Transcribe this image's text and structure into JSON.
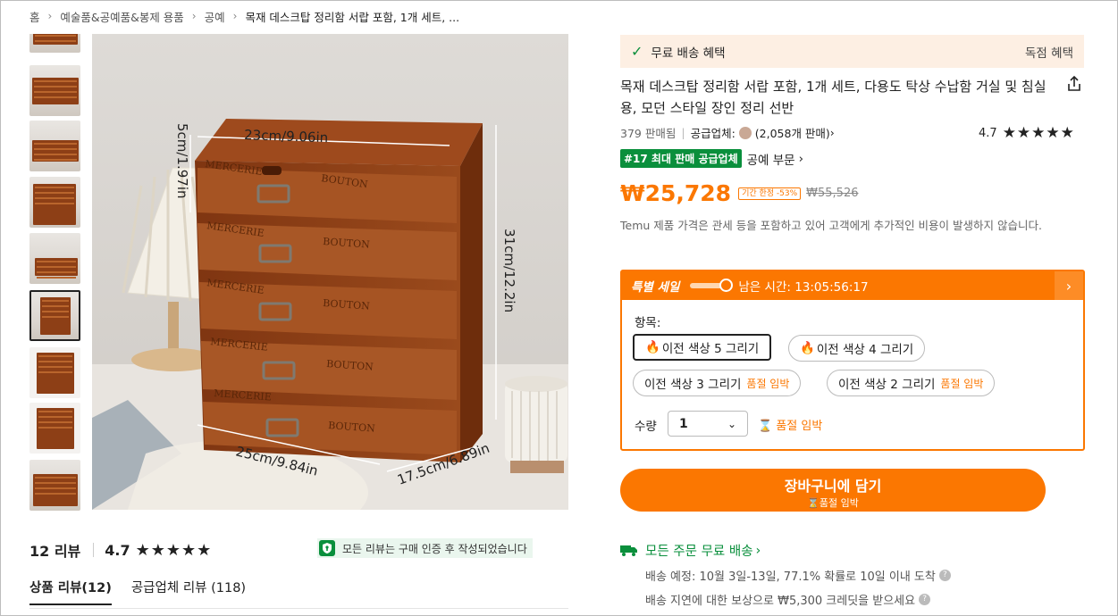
{
  "breadcrumb": [
    "홈",
    "예술품&공예품&봉제 용품",
    "공예",
    "목재 데스크탑 정리함 서랍 포함, 1개 세트, ..."
  ],
  "image_labels": {
    "width": "23cm/9.06in",
    "drawer_height": "5cm/1.97in",
    "height": "31cm/12.2in",
    "depth_front": "25cm/9.84in",
    "depth_side": "17.5cm/6.89in",
    "drawer_text_left": "MERCERIE",
    "drawer_text_right": "BOUTON"
  },
  "benefit": {
    "label": "무료 배송 혜택",
    "right": "독점 혜택"
  },
  "product": {
    "title": "목재 데스크탑 정리함 서랍 포함, 1개 세트, 다용도 탁상 수납함 거실 및 침실용, 모던 스타일 장인 정리 선반",
    "sold": "379 판매됨",
    "seller_label": "공급업체:",
    "seller_sales": "(2,058개 판매)",
    "rating": "4.7",
    "rank_badge": "#17 최대 판매 공급업체",
    "rank_category": "공예 부문"
  },
  "price": {
    "current": "₩25,728",
    "limited_badge": "기간 한정 -53%",
    "original": "₩55,526",
    "note": "Temu 제품 가격은 관세 등을 포함하고 있어 고객에게 추가적인 비용이 발생하지 않습니다."
  },
  "sale": {
    "title": "특별 세일",
    "timer_label": "남은 시간: 13:05:56:17",
    "timer_progress": 0.9,
    "options_label": "항목:",
    "options": [
      {
        "label": "이전 색상 5 그리기",
        "selected": true,
        "sold_out": ""
      },
      {
        "label": "이전 색상 4 그리기",
        "selected": false,
        "sold_out": ""
      },
      {
        "label": "이전 색상 3 그리기",
        "selected": false,
        "sold_out": "품절 임박"
      },
      {
        "label": "이전 색상 2 그리기",
        "selected": false,
        "sold_out": "품절 임박"
      }
    ],
    "qty_label": "수량",
    "qty_value": "1",
    "stock_note": "품절 임박"
  },
  "cart": {
    "label": "장바구니에 담기",
    "sub": "품절 임박"
  },
  "shipping": {
    "head": "모든 주문 무료 배송",
    "eta": "배송 예정: 10월 3일-13일, 77.1% 확률로 10일 이내 도착",
    "delay": "배송 지연에 대한 보상으로 ₩5,300 크레딧을 받으세요"
  },
  "reviews": {
    "count": "12 리뷰",
    "rating": "4.7",
    "verified": "모든 리뷰는 구매 인증 후 작성되었습니다",
    "tabs": [
      "상품 리뷰(12)",
      "공급업체 리뷰 (118)"
    ]
  },
  "colors": {
    "accent": "#fb7701",
    "green": "#0a8f3c"
  }
}
